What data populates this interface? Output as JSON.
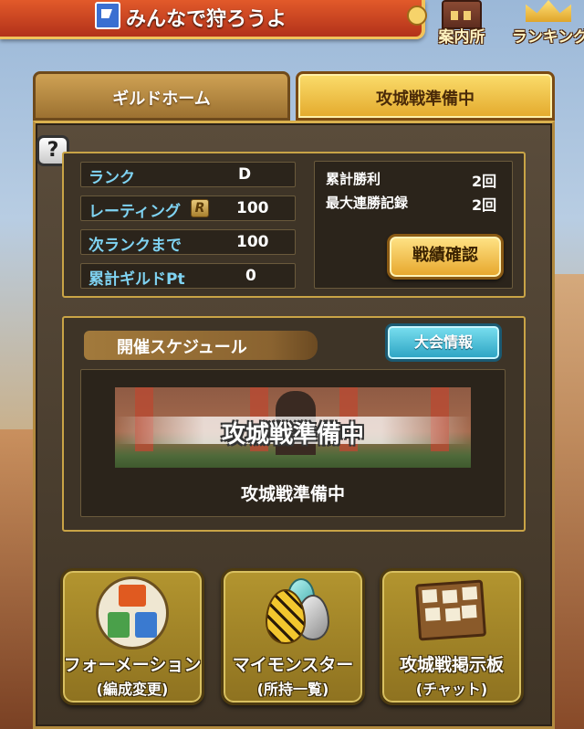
{
  "header": {
    "title": "みんなで狩ろうよ",
    "guide_label": "案内所",
    "ranking_label": "ランキング"
  },
  "tabs": [
    {
      "label": "ギルドホーム",
      "active": false
    },
    {
      "label": "攻城戦準備中",
      "active": true
    }
  ],
  "help": {
    "label": "?"
  },
  "stats": {
    "rank_label": "ランク",
    "rank_value": "D",
    "rating_label": "レーティング",
    "rating_badge": "R",
    "rating_value": "100",
    "next_rank_label": "次ランクまで",
    "next_rank_value": "100",
    "guild_pt_label": "累計ギルドPt",
    "guild_pt_value": "0"
  },
  "record": {
    "total_wins_label": "累計勝利",
    "total_wins_value": "2回",
    "max_streak_label": "最大連勝記録",
    "max_streak_value": "2回",
    "battle_record_button": "戦績確認"
  },
  "schedule": {
    "header": "開催スケジュール",
    "tournament_info_button": "大会情報",
    "banner_text": "攻城戦準備中",
    "status_text": "攻城戦準備中"
  },
  "menu": [
    {
      "title": "フォーメーション",
      "sub": "(編成変更)",
      "icon": "formation-icon"
    },
    {
      "title": "マイモンスター",
      "sub": "(所持一覧)",
      "icon": "monster-eggs-icon"
    },
    {
      "title": "攻城戦掲示板",
      "sub": "(チャット)",
      "icon": "bulletin-board-icon"
    }
  ],
  "colors": {
    "accent_gold": "#e3a92c",
    "label_cyan": "#7fd3f2",
    "header_red": "#c23e1e",
    "tournament_teal": "#2aa2c2"
  }
}
